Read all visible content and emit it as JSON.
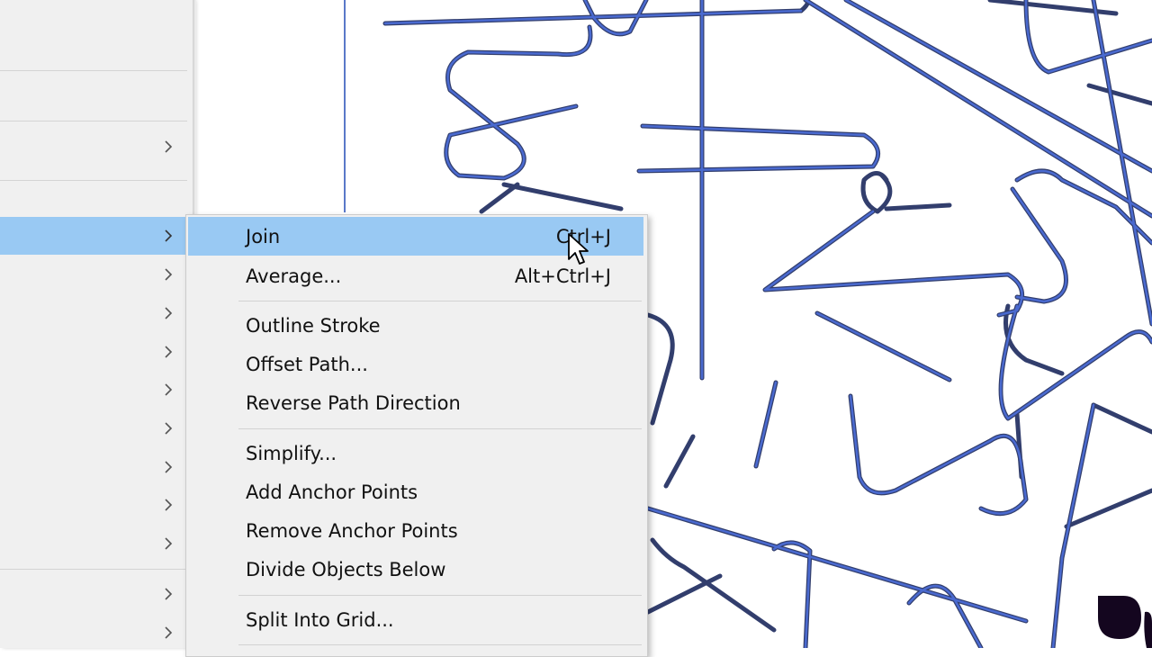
{
  "submenu": {
    "items": [
      {
        "label": "Join",
        "shortcut": "Ctrl+J"
      },
      {
        "label": "Average...",
        "shortcut": "Alt+Ctrl+J"
      },
      {
        "label": "Outline Stroke",
        "shortcut": ""
      },
      {
        "label": "Offset Path...",
        "shortcut": ""
      },
      {
        "label": "Reverse Path Direction",
        "shortcut": ""
      },
      {
        "label": "Simplify...",
        "shortcut": ""
      },
      {
        "label": "Add Anchor Points",
        "shortcut": ""
      },
      {
        "label": "Remove Anchor Points",
        "shortcut": ""
      },
      {
        "label": "Divide Objects Below",
        "shortcut": ""
      },
      {
        "label": "Split Into Grid...",
        "shortcut": ""
      }
    ],
    "highlighted_item": "Join"
  },
  "parent_menu": {
    "submenu_arrows": [
      "chevron-right-icon"
    ],
    "highlighted_row": 2
  },
  "colors": {
    "menu_bg": "#f0f0f0",
    "highlight": "#99c9f3",
    "path_stroke": "#3a55a8"
  },
  "icons": {
    "cursor": "arrow-cursor-icon",
    "submenu_arrow": "chevron-right-icon",
    "logo": "brand-logo-icon"
  }
}
